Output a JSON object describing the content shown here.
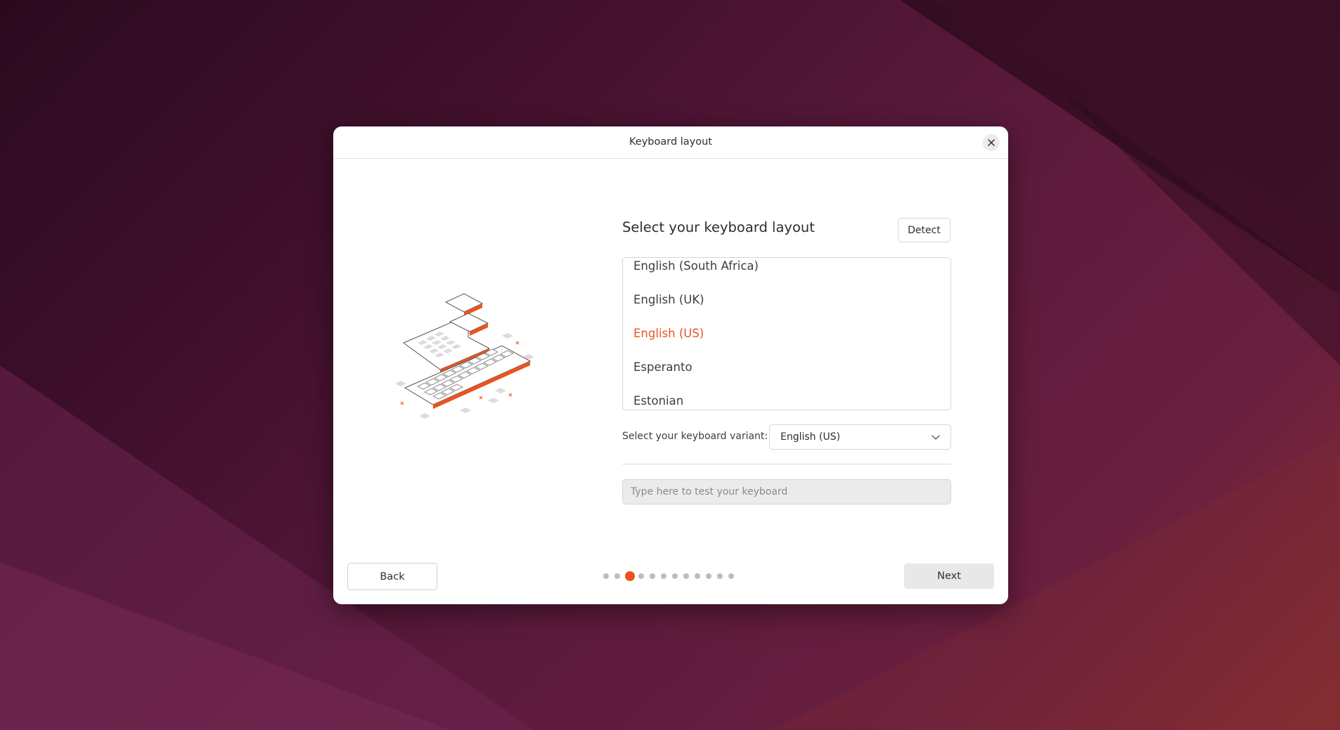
{
  "dialog": {
    "title": "Keyboard layout",
    "heading": "Select your keyboard layout",
    "detect_label": "Detect",
    "layouts": [
      {
        "label": "English (South Africa)",
        "selected": false
      },
      {
        "label": "English (UK)",
        "selected": false
      },
      {
        "label": "English (US)",
        "selected": true
      },
      {
        "label": "Esperanto",
        "selected": false
      },
      {
        "label": "Estonian",
        "selected": false
      }
    ],
    "variant_label": "Select your keyboard variant:",
    "variant_value": "English (US)",
    "test_placeholder": "Type here to test your keyboard",
    "back_label": "Back",
    "next_label": "Next"
  },
  "pager": {
    "total": 12,
    "current": 3
  },
  "colors": {
    "accent": "#e95420",
    "dot_inactive": "#bdbdbd"
  },
  "icons": {
    "close": "close-icon",
    "dropdown": "chevron-down-icon"
  }
}
